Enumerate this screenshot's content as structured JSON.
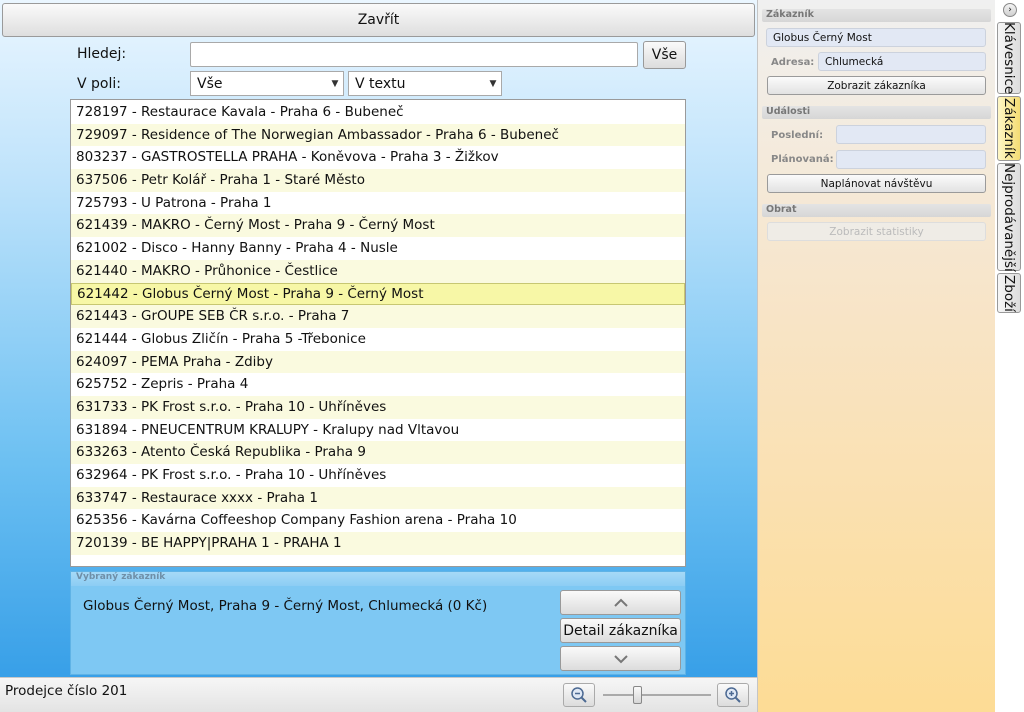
{
  "header": {
    "close_label": "Zavřít"
  },
  "search": {
    "label": "Hledej:",
    "value": "",
    "all_label": "Vše"
  },
  "filter": {
    "label": "V poli:",
    "field_value": "Vše",
    "mode_value": "V textu"
  },
  "customers": [
    "728197 - Restaurace Kavala - Praha 6 - Bubeneč",
    "729097 - Residence of The Norwegian Ambassador - Praha 6 - Bubeneč",
    "803237 - GASTROSTELLA PRAHA - Koněvova - Praha 3 - Žižkov",
    "637506 - Petr Kolář - Praha 1 - Staré Město",
    "725793 - U Patrona - Praha 1",
    "621439 - MAKRO - Černý Most - Praha 9 - Černý Most",
    "621002 - Disco - Hanny Banny - Praha 4 - Nusle",
    "621440 - MAKRO - Průhonice - Čestlice",
    "621442 - Globus Černý Most - Praha 9 - Černý Most",
    "621443 - GrOUPE SEB ČR s.r.o. - Praha 7",
    "621444 - Globus Zličín - Praha 5 -Třebonice",
    "624097 - PEMA Praha - Zdiby",
    "625752 - Zepris - Praha 4",
    "631733 - PK Frost s.r.o. - Praha 10 - Uhříněves",
    "631894 - PNEUCENTRUM KRALUPY - Kralupy nad Vltavou",
    "633263 - Atento Česká Republika - Praha 9",
    "632964 - PK Frost s.r.o. - Praha 10 - Uhříněves",
    "633747 - Restaurace xxxx - Praha 1",
    "625356 - Kavárna Coffeeshop Company Fashion arena - Praha 10",
    "720139 - BE HAPPY|PRAHA 1 - PRAHA 1"
  ],
  "selected_index": 8,
  "selected_panel": {
    "header": "Vybraný zákazník",
    "text": "Globus Černý Most, Praha 9 - Černý Most, Chlumecká (0 Kč)",
    "detail_label": "Detail zákazníka"
  },
  "status": {
    "seller": "Prodejce číslo 201",
    "zoom_level": 0.32
  },
  "sidebar": {
    "customer": {
      "header": "Zákazník",
      "name": "Globus Černý Most",
      "address_label": "Adresa:",
      "address_value": "Chlumecká",
      "show_button": "Zobrazit zákazníka"
    },
    "events": {
      "header": "Události",
      "last_label": "Poslední:",
      "last_value": "",
      "planned_label": "Plánovaná:",
      "planned_value": "",
      "plan_button": "Naplánovat návštěvu"
    },
    "turnover": {
      "header": "Obrat",
      "stats_button": "Zobrazit statistiky"
    }
  },
  "tabs": [
    "Klávesnice",
    "Zákazník",
    "Nejprodávanější",
    "Zboží"
  ],
  "active_tab": 1
}
